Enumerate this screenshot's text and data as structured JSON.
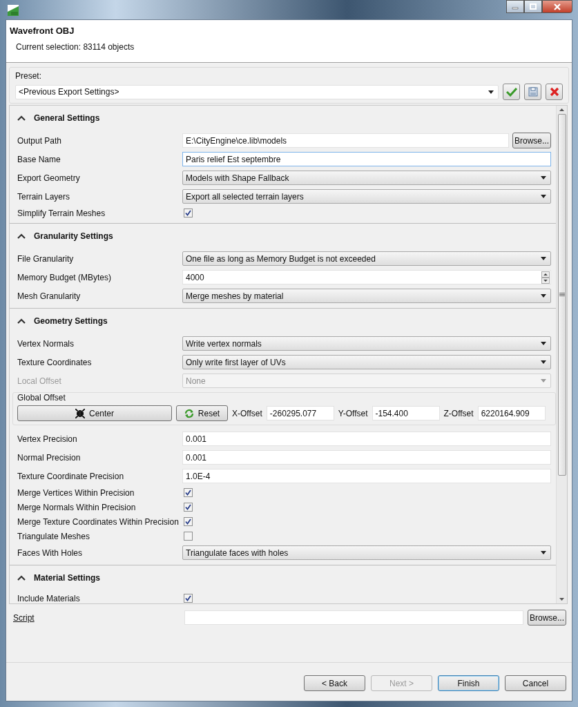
{
  "header": {
    "title": "Wavefront OBJ",
    "subtitle": "Current selection: 83114 objects"
  },
  "preset": {
    "label": "Preset:",
    "value": "<Previous Export Settings>"
  },
  "sections": [
    {
      "title": "General Settings",
      "expanded": true,
      "rows": [
        {
          "kind": "text",
          "label": "Output Path",
          "value": "E:\\CityEngine\\ce.lib\\models",
          "button": "Browse...",
          "focused": false
        },
        {
          "kind": "text",
          "label": "Base Name",
          "value": "Paris relief Est septembre",
          "focused": true
        },
        {
          "kind": "select",
          "label": "Export Geometry",
          "value": "Models with Shape Fallback",
          "disabled": false
        },
        {
          "kind": "select",
          "label": "Terrain Layers",
          "value": "Export all selected terrain layers",
          "disabled": false
        },
        {
          "kind": "checkbox",
          "label": "Simplify Terrain Meshes",
          "checked": true
        }
      ]
    },
    {
      "title": "Granularity Settings",
      "expanded": true,
      "rows": [
        {
          "kind": "select",
          "label": "File Granularity",
          "value": "One file as long as Memory Budget is not exceeded",
          "disabled": false
        },
        {
          "kind": "spinner",
          "label": "Memory Budget (MBytes)",
          "value": "4000"
        },
        {
          "kind": "select",
          "label": "Mesh Granularity",
          "value": "Merge meshes by material",
          "disabled": false
        }
      ]
    },
    {
      "title": "Geometry Settings",
      "expanded": true,
      "rows": [
        {
          "kind": "select",
          "label": "Vertex Normals",
          "value": "Write vertex normals",
          "disabled": false
        },
        {
          "kind": "select",
          "label": "Texture Coordinates",
          "value": "Only write first layer of UVs",
          "disabled": false
        },
        {
          "kind": "select",
          "label": "Local Offset",
          "value": "None",
          "disabled": true
        },
        {
          "kind": "offset",
          "label": "Global Offset",
          "buttons": [
            {
              "label": "Center"
            },
            {
              "label": "Reset"
            }
          ],
          "fields": [
            {
              "label": "X-Offset",
              "value": "-260295.077"
            },
            {
              "label": "Y-Offset",
              "value": "-154.400"
            },
            {
              "label": "Z-Offset",
              "value": "6220164.909"
            }
          ]
        },
        {
          "kind": "text",
          "label": "Vertex Precision",
          "value": "0.001",
          "focused": false
        },
        {
          "kind": "text",
          "label": "Normal Precision",
          "value": "0.001",
          "focused": false
        },
        {
          "kind": "text",
          "label": "Texture Coordinate Precision",
          "value": "1.0E-4",
          "focused": false
        },
        {
          "kind": "checkbox",
          "label": "Merge Vertices Within Precision",
          "checked": true
        },
        {
          "kind": "checkbox",
          "label": "Merge Normals Within Precision",
          "checked": true
        },
        {
          "kind": "checkbox",
          "label": "Merge Texture Coordinates Within Precision",
          "checked": true
        },
        {
          "kind": "checkbox",
          "label": "Triangulate Meshes",
          "checked": false
        },
        {
          "kind": "select",
          "label": "Faces With Holes",
          "value": "Triangulate faces with holes",
          "disabled": false
        }
      ]
    },
    {
      "title": "Material Settings",
      "expanded": true,
      "rows": [
        {
          "kind": "checkbox",
          "label": "Include Materials",
          "checked": true
        }
      ]
    }
  ],
  "script": {
    "label": "Script",
    "button": "Browse..."
  },
  "buttons": [
    {
      "label": "< Back",
      "disabled": false,
      "default": false
    },
    {
      "label": "Next >",
      "disabled": true,
      "default": false
    },
    {
      "label": "Finish",
      "disabled": false,
      "default": true
    },
    {
      "label": "Cancel",
      "disabled": false,
      "default": false
    }
  ]
}
